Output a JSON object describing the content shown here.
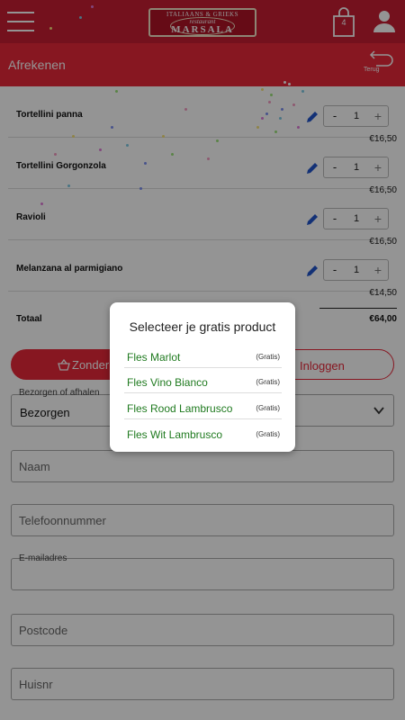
{
  "header": {
    "logo_line1": "ITALIAANS & GRIEKS",
    "logo_line2": "restaurant",
    "logo_line3": "MARSALA",
    "cart_count": "4",
    "page_title": "Afrekenen",
    "back_label": "Terug"
  },
  "order": {
    "items": [
      {
        "name": "Tortellini panna",
        "qty": "1",
        "price": "€16,50"
      },
      {
        "name": "Tortellini Gorgonzola",
        "qty": "1",
        "price": "€16,50"
      },
      {
        "name": "Ravioli",
        "qty": "1",
        "price": "€16,50"
      },
      {
        "name": "Melanzana al parmigiano",
        "qty": "1",
        "price": "€14,50"
      }
    ],
    "minus": "-",
    "plus": "+",
    "total_label": "Totaal",
    "total_amount": "€64,00"
  },
  "form": {
    "zonder_label": "Zonder",
    "inloggen_label": "Inloggen",
    "delivery_label": "Bezorgen of afhalen",
    "delivery_value": "Bezorgen",
    "name_placeholder": "Naam",
    "phone_placeholder": "Telefoonnummer",
    "email_label": "E-mailadres",
    "postcode_placeholder": "Postcode",
    "houseno_placeholder": "Huisnr"
  },
  "modal": {
    "title": "Selecteer je gratis product",
    "options": [
      {
        "name": "Fles Marlot",
        "tag": "(Gratis)"
      },
      {
        "name": "Fles Vino Bianco",
        "tag": "(Gratis)"
      },
      {
        "name": "Fles Rood Lambrusco",
        "tag": "(Gratis)"
      },
      {
        "name": "Fles Wit Lambrusco",
        "tag": "(Gratis)"
      }
    ]
  },
  "colors": {
    "brand_red": "#e8283a",
    "header_red": "#c81e32",
    "option_green": "#1f7a1f",
    "edit_blue": "#2255cc"
  }
}
